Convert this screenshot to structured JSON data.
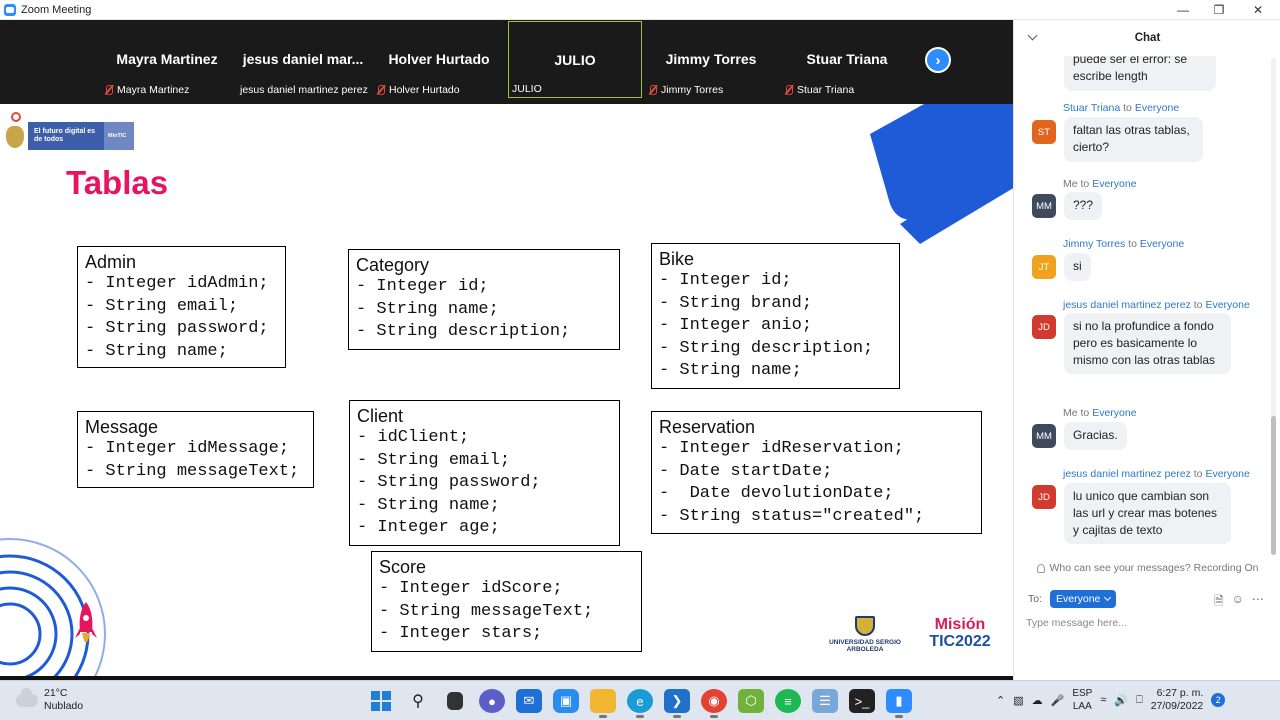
{
  "window": {
    "title": "Zoom Meeting"
  },
  "participants": [
    {
      "big_name": "Mayra Martinez",
      "small_name": "Mayra Martinez",
      "muted": true
    },
    {
      "big_name": "jesus  daniel  mar...",
      "small_name": "jesus daniel martinez perez",
      "muted": false
    },
    {
      "big_name": "Holver Hurtado",
      "small_name": "Holver Hurtado",
      "muted": true
    },
    {
      "big_name": "JULIO",
      "small_name": "JULIO",
      "muted": false,
      "active_speaker": true
    },
    {
      "big_name": "Jimmy Torres",
      "small_name": "Jimmy Torres",
      "muted": true
    },
    {
      "big_name": "Stuar Triana",
      "small_name": "Stuar Triana",
      "muted": true
    }
  ],
  "slide": {
    "title": "Tablas",
    "logo_text": "El futuro digital es de todos",
    "logo_brand": "MinTIC",
    "university": "UNIVERSIDAD SERGIO ARBOLEDA",
    "mision": "Misión",
    "mision_year": "TIC2022",
    "classes": [
      {
        "name": "Admin",
        "fields": [
          "- Integer idAdmin;",
          "- String email;",
          "- String password;",
          "- String name;"
        ]
      },
      {
        "name": "Category",
        "fields": [
          "- Integer id;",
          "- String name;",
          "- String description;"
        ]
      },
      {
        "name": "Bike",
        "fields": [
          "- Integer id;",
          "- String brand;",
          "- Integer anio;",
          "- String description;",
          "- String name;"
        ]
      },
      {
        "name": "Message",
        "fields": [
          "- Integer idMessage;",
          "- String messageText;"
        ]
      },
      {
        "name": "Client",
        "fields": [
          "- idClient;",
          "- String email;",
          "- String password;",
          "- String name;",
          "- Integer age;"
        ]
      },
      {
        "name": "Reservation",
        "fields": [
          "- Integer idReservation;",
          "- Date startDate;",
          "-  Date devolutionDate;",
          "- String status=\"created\";"
        ]
      },
      {
        "name": "Score",
        "fields": [
          "- Integer idScore;",
          "- String messageText;",
          "- Integer stars;"
        ]
      }
    ]
  },
  "chat": {
    "title": "Chat",
    "messages": [
      {
        "sender": "",
        "target": "",
        "initials": "",
        "avatar_color": "",
        "text": "puede ser el error: se escribe length",
        "partial": true
      },
      {
        "sender": "Stuar Triana",
        "target": "Everyone",
        "initials": "ST",
        "avatar_color": "#e0661f",
        "text": "faltan las otras tablas, cierto?"
      },
      {
        "sender": "Me",
        "target": "Everyone",
        "initials": "MM",
        "avatar_color": "#3f4a5c",
        "text": "???"
      },
      {
        "sender": "Jimmy Torres",
        "target": "Everyone",
        "initials": "JT",
        "avatar_color": "#f0a21e",
        "text": "si"
      },
      {
        "sender": "jesus daniel martinez perez",
        "target": "Everyone",
        "initials": "JD",
        "avatar_color": "#d13b2f",
        "text": "si no la profundice  a fondo pero es basicamente lo mismo con las otras tablas"
      },
      {
        "sender": "Me",
        "target": "Everyone",
        "initials": "MM",
        "avatar_color": "#3f4a5c",
        "text": "Gracias."
      },
      {
        "sender": "jesus daniel martinez perez",
        "target": "Everyone",
        "initials": "JD",
        "avatar_color": "#d13b2f",
        "text": "lu unico que cambian son las url y crear mas botenes y  cajitas de texto"
      }
    ],
    "to_word": "to",
    "privacy_note": "Who can see your messages? Recording On",
    "to_label": "To:",
    "recipient": "Everyone",
    "input_placeholder": "Type message here..."
  },
  "taskbar": {
    "weather_temp": "21°C",
    "weather_desc": "Nublado",
    "lang_1": "ESP",
    "lang_2": "LAA",
    "time": "6:27 p. m.",
    "date": "27/09/2022",
    "notifications": "2"
  }
}
